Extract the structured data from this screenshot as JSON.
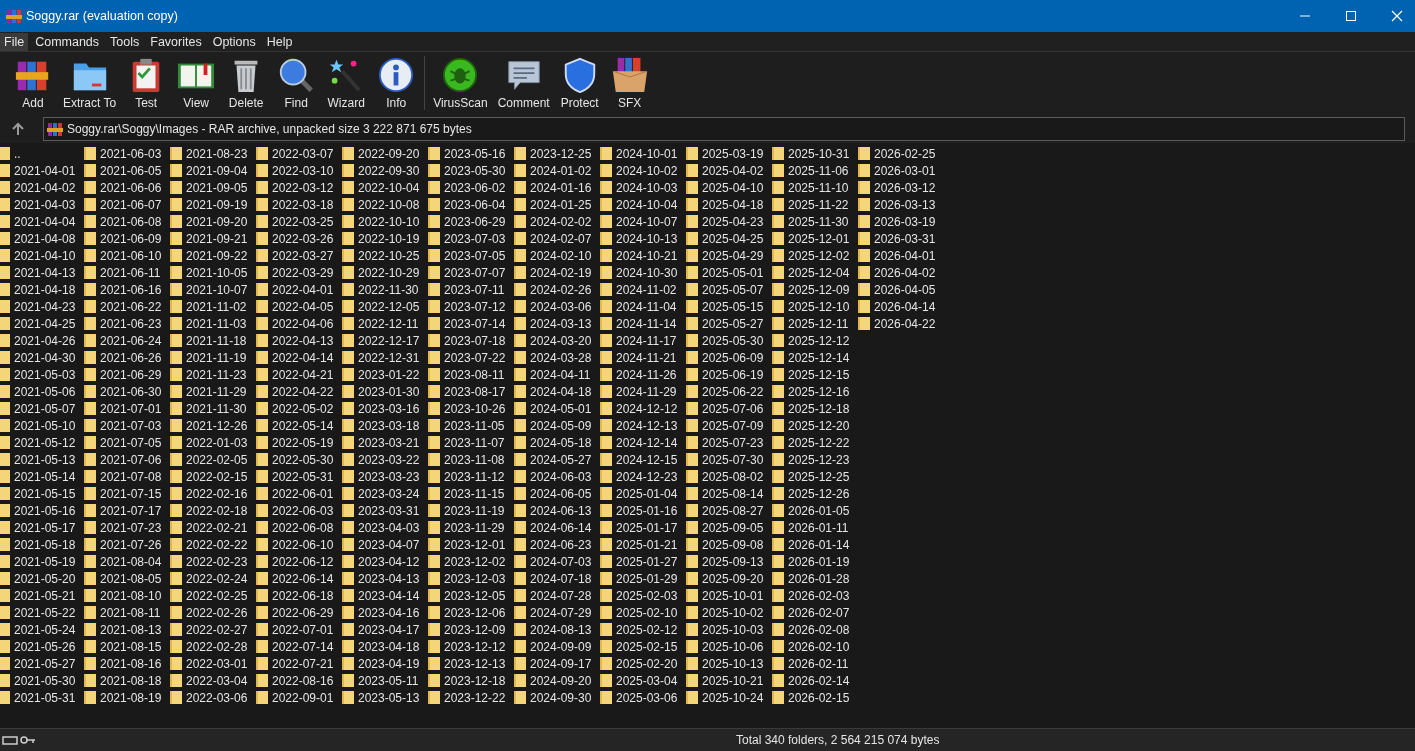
{
  "window": {
    "title": "Soggy.rar (evaluation copy)"
  },
  "menu": [
    {
      "label": "File",
      "selected": true
    },
    {
      "label": "Commands",
      "selected": false
    },
    {
      "label": "Tools",
      "selected": false
    },
    {
      "label": "Favorites",
      "selected": false
    },
    {
      "label": "Options",
      "selected": false
    },
    {
      "label": "Help",
      "selected": false
    }
  ],
  "toolbar_groups": [
    [
      "Add",
      "Extract To",
      "Test",
      "View",
      "Delete",
      "Find",
      "Wizard",
      "Info"
    ],
    [
      "VirusScan",
      "Comment",
      "Protect",
      "SFX"
    ]
  ],
  "address": {
    "path": "Soggy.rar\\Soggy\\Images - RAR archive, unpacked size 3 222 871 675 bytes"
  },
  "items": [
    "..",
    "2021-04-01",
    "2021-04-02",
    "2021-04-03",
    "2021-04-04",
    "2021-04-08",
    "2021-04-10",
    "2021-04-13",
    "2021-04-18",
    "2021-04-23",
    "2021-04-25",
    "2021-04-26",
    "2021-04-30",
    "2021-05-03",
    "2021-05-06",
    "2021-05-07",
    "2021-05-10",
    "2021-05-12",
    "2021-05-13",
    "2021-05-14",
    "2021-05-15",
    "2021-05-16",
    "2021-05-17",
    "2021-05-18",
    "2021-05-19",
    "2021-05-20",
    "2021-05-21",
    "2021-05-22",
    "2021-05-24",
    "2021-05-26",
    "2021-05-27",
    "2021-05-30",
    "2021-05-31",
    "2021-06-03",
    "2021-06-05",
    "2021-06-06",
    "2021-06-07",
    "2021-06-08",
    "2021-06-09",
    "2021-06-10",
    "2021-06-11",
    "2021-06-16",
    "2021-06-22",
    "2021-06-23",
    "2021-06-24",
    "2021-06-26",
    "2021-06-29",
    "2021-06-30",
    "2021-07-01",
    "2021-07-03",
    "2021-07-05",
    "2021-07-06",
    "2021-07-08",
    "2021-07-15",
    "2021-07-17",
    "2021-07-23",
    "2021-07-26",
    "2021-08-04",
    "2021-08-05",
    "2021-08-10",
    "2021-08-11",
    "2021-08-13",
    "2021-08-15",
    "2021-08-16",
    "2021-08-18",
    "2021-08-19",
    "2021-08-23",
    "2021-09-04",
    "2021-09-05",
    "2021-09-19",
    "2021-09-20",
    "2021-09-21",
    "2021-09-22",
    "2021-10-05",
    "2021-10-07",
    "2021-11-02",
    "2021-11-03",
    "2021-11-18",
    "2021-11-19",
    "2021-11-23",
    "2021-11-29",
    "2021-11-30",
    "2021-12-26",
    "2022-01-03",
    "2022-02-05",
    "2022-02-15",
    "2022-02-16",
    "2022-02-18",
    "2022-02-21",
    "2022-02-22",
    "2022-02-23",
    "2022-02-24",
    "2022-02-25",
    "2022-02-26",
    "2022-02-27",
    "2022-02-28",
    "2022-03-01",
    "2022-03-04",
    "2022-03-06",
    "2022-03-07",
    "2022-03-10",
    "2022-03-12",
    "2022-03-18",
    "2022-03-25",
    "2022-03-26",
    "2022-03-27",
    "2022-03-29",
    "2022-04-01",
    "2022-04-05",
    "2022-04-06",
    "2022-04-13",
    "2022-04-14",
    "2022-04-21",
    "2022-04-22",
    "2022-05-02",
    "2022-05-14",
    "2022-05-19",
    "2022-05-30",
    "2022-05-31",
    "2022-06-01",
    "2022-06-03",
    "2022-06-08",
    "2022-06-10",
    "2022-06-12",
    "2022-06-14",
    "2022-06-18",
    "2022-06-29",
    "2022-07-01",
    "2022-07-14",
    "2022-07-21",
    "2022-08-16",
    "2022-09-01",
    "2022-09-20",
    "2022-09-30",
    "2022-10-04",
    "2022-10-08",
    "2022-10-10",
    "2022-10-19",
    "2022-10-25",
    "2022-10-29",
    "2022-11-30",
    "2022-12-05",
    "2022-12-11",
    "2022-12-17",
    "2022-12-31",
    "2023-01-22",
    "2023-01-30",
    "2023-03-16",
    "2023-03-18",
    "2023-03-21",
    "2023-03-22",
    "2023-03-23",
    "2023-03-24",
    "2023-03-31",
    "2023-04-03",
    "2023-04-07",
    "2023-04-12",
    "2023-04-13",
    "2023-04-14",
    "2023-04-16",
    "2023-04-17",
    "2023-04-18",
    "2023-04-19",
    "2023-05-11",
    "2023-05-13",
    "2023-05-16",
    "2023-05-30",
    "2023-06-02",
    "2023-06-04",
    "2023-06-29",
    "2023-07-03",
    "2023-07-05",
    "2023-07-07",
    "2023-07-11",
    "2023-07-12",
    "2023-07-14",
    "2023-07-18",
    "2023-07-22",
    "2023-08-11",
    "2023-08-17",
    "2023-10-26",
    "2023-11-05",
    "2023-11-07",
    "2023-11-08",
    "2023-11-12",
    "2023-11-15",
    "2023-11-19",
    "2023-11-29",
    "2023-12-01",
    "2023-12-02",
    "2023-12-03",
    "2023-12-05",
    "2023-12-06",
    "2023-12-09",
    "2023-12-12",
    "2023-12-13",
    "2023-12-18",
    "2023-12-22",
    "2023-12-25",
    "2024-01-02",
    "2024-01-16",
    "2024-01-25",
    "2024-02-02",
    "2024-02-07",
    "2024-02-10",
    "2024-02-19",
    "2024-02-26",
    "2024-03-06",
    "2024-03-13",
    "2024-03-20",
    "2024-03-28",
    "2024-04-11",
    "2024-04-18",
    "2024-05-01",
    "2024-05-09",
    "2024-05-18",
    "2024-05-27",
    "2024-06-03",
    "2024-06-05",
    "2024-06-13",
    "2024-06-14",
    "2024-06-23",
    "2024-07-03",
    "2024-07-18",
    "2024-07-28",
    "2024-07-29",
    "2024-08-13",
    "2024-09-09",
    "2024-09-17",
    "2024-09-20",
    "2024-09-30",
    "2024-10-01",
    "2024-10-02",
    "2024-10-03",
    "2024-10-04",
    "2024-10-07",
    "2024-10-13",
    "2024-10-21",
    "2024-10-30",
    "2024-11-02",
    "2024-11-04",
    "2024-11-14",
    "2024-11-17",
    "2024-11-21",
    "2024-11-26",
    "2024-11-29",
    "2024-12-12",
    "2024-12-13",
    "2024-12-14",
    "2024-12-15",
    "2024-12-23",
    "2025-01-04",
    "2025-01-16",
    "2025-01-17",
    "2025-01-21",
    "2025-01-27",
    "2025-01-29",
    "2025-02-03",
    "2025-02-10",
    "2025-02-12",
    "2025-02-15",
    "2025-02-20",
    "2025-03-04",
    "2025-03-06",
    "2025-03-19",
    "2025-04-02",
    "2025-04-10",
    "2025-04-18",
    "2025-04-23",
    "2025-04-25",
    "2025-04-29",
    "2025-05-01",
    "2025-05-07",
    "2025-05-15",
    "2025-05-27",
    "2025-05-30",
    "2025-06-09",
    "2025-06-19",
    "2025-06-22",
    "2025-07-06",
    "2025-07-09",
    "2025-07-23",
    "2025-07-30",
    "2025-08-02",
    "2025-08-14",
    "2025-08-27",
    "2025-09-05",
    "2025-09-08",
    "2025-09-13",
    "2025-09-20",
    "2025-10-01",
    "2025-10-02",
    "2025-10-03",
    "2025-10-06",
    "2025-10-13",
    "2025-10-21",
    "2025-10-24",
    "2025-10-31",
    "2025-11-06",
    "2025-11-10",
    "2025-11-22",
    "2025-11-30",
    "2025-12-01",
    "2025-12-02",
    "2025-12-04",
    "2025-12-09",
    "2025-12-10",
    "2025-12-11",
    "2025-12-12",
    "2025-12-14",
    "2025-12-15",
    "2025-12-16",
    "2025-12-18",
    "2025-12-20",
    "2025-12-22",
    "2025-12-23",
    "2025-12-25",
    "2025-12-26",
    "2026-01-05",
    "2026-01-11",
    "2026-01-14",
    "2026-01-19",
    "2026-01-28",
    "2026-02-03",
    "2026-02-07",
    "2026-02-08",
    "2026-02-10",
    "2026-02-11",
    "2026-02-14",
    "2026-02-15",
    "2026-02-25",
    "2026-03-01",
    "2026-03-12",
    "2026-03-13",
    "2026-03-19",
    "2026-03-31",
    "2026-04-01",
    "2026-04-02",
    "2026-04-05",
    "2026-04-14",
    "2026-04-22"
  ],
  "status_bar": {
    "total": "Total 340 folders, 2 564 215 074 bytes"
  }
}
